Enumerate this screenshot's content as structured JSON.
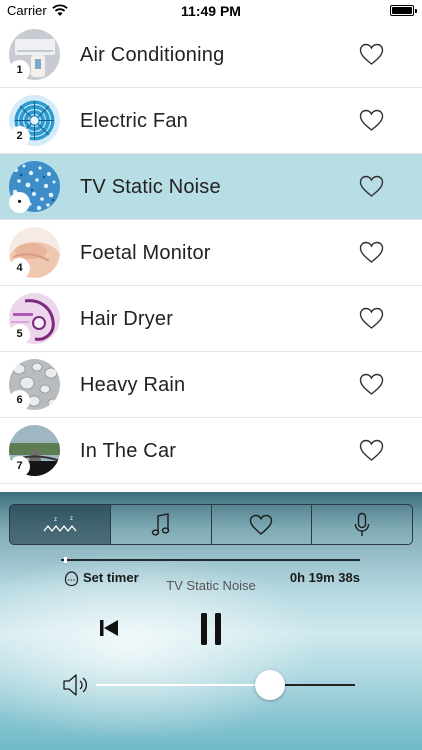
{
  "status_bar": {
    "carrier": "Carrier",
    "time": "11:49 PM"
  },
  "sounds": [
    {
      "number": "1",
      "label": "Air Conditioning",
      "icon": "air-conditioner-photo",
      "active": false
    },
    {
      "number": "2",
      "label": "Electric Fan",
      "icon": "electric-fan-photo",
      "active": false
    },
    {
      "number": "•",
      "label": "TV Static Noise",
      "icon": "tv-static-photo",
      "active": true
    },
    {
      "number": "4",
      "label": "Foetal Monitor",
      "icon": "foetal-monitor-photo",
      "active": false
    },
    {
      "number": "5",
      "label": "Hair Dryer",
      "icon": "hair-dryer-photo",
      "active": false
    },
    {
      "number": "6",
      "label": "Heavy Rain",
      "icon": "heavy-rain-photo",
      "active": false
    },
    {
      "number": "7",
      "label": "In The Car",
      "icon": "in-the-car-photo",
      "active": false
    }
  ],
  "player": {
    "tabs": [
      "sleep-waves-icon",
      "music-note-icon",
      "heart-icon",
      "microphone-icon"
    ],
    "selected_tab": 0,
    "set_timer_label": "Set timer",
    "now_playing": "TV Static Noise",
    "remaining": "0h 19m 38s",
    "progress": 0.01,
    "volume": 0.67
  },
  "colors": {
    "active_row": "#b7dde5",
    "divider": "#e5e5e5"
  }
}
